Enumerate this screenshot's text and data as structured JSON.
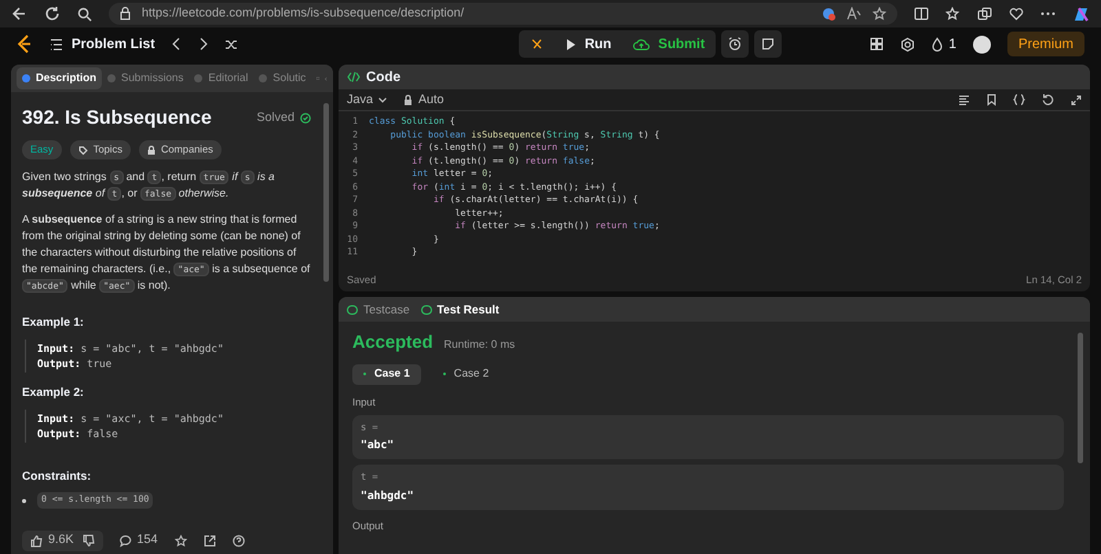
{
  "browser": {
    "url": "https://leetcode.com/problems/is-subsequence/description/"
  },
  "topbar": {
    "problem_list": "Problem List",
    "run": "Run",
    "submit": "Submit",
    "streak": "1",
    "premium": "Premium"
  },
  "description": {
    "tabs": [
      {
        "label": "Description",
        "selected": true
      },
      {
        "label": "Submissions",
        "selected": false
      },
      {
        "label": "Editorial",
        "selected": false
      },
      {
        "label": "Solutic",
        "selected": false
      }
    ],
    "title": "392. Is Subsequence",
    "status": "Solved",
    "tags": [
      {
        "label": "Easy",
        "kind": "difficulty"
      },
      {
        "label": "Topics",
        "kind": "topics"
      },
      {
        "label": "Companies",
        "kind": "companies"
      }
    ],
    "paragraphs": [
      [
        {
          "text": "Given two strings ",
          "kind": "text"
        },
        {
          "text": "s",
          "kind": "code"
        },
        {
          "text": " and ",
          "kind": "text"
        },
        {
          "text": "t",
          "kind": "code"
        },
        {
          "text": ", return ",
          "kind": "text"
        },
        {
          "text": "true",
          "kind": "code"
        },
        {
          "text": " if ",
          "kind": "italic"
        },
        {
          "text": "s",
          "kind": "code"
        },
        {
          "text": " is a ",
          "kind": "italic"
        },
        {
          "text": "subsequence",
          "kind": "bolditalic"
        },
        {
          "text": " of ",
          "kind": "italic"
        },
        {
          "text": "t",
          "kind": "code"
        },
        {
          "text": ", or ",
          "kind": "text"
        },
        {
          "text": "false",
          "kind": "code"
        },
        {
          "text": " otherwise.",
          "kind": "italic"
        }
      ],
      [
        {
          "text": "A ",
          "kind": "text"
        },
        {
          "text": "subsequence",
          "kind": "bold"
        },
        {
          "text": " of a string is a new string that is formed from the original string by deleting some (can be none) of the characters without disturbing the relative positions of the remaining characters. (i.e., ",
          "kind": "text"
        },
        {
          "text": "\"ace\"",
          "kind": "code"
        },
        {
          "text": " is a subsequence of ",
          "kind": "text"
        },
        {
          "text": "\"abcde\"",
          "kind": "code"
        },
        {
          "text": " while ",
          "kind": "text"
        },
        {
          "text": "\"aec\"",
          "kind": "code"
        },
        {
          "text": " is not).",
          "kind": "text"
        }
      ]
    ],
    "examples": [
      {
        "title": "Example 1:",
        "input_label": "Input:",
        "input": "s = \"abc\", t = \"ahbgdc\"",
        "output_label": "Output:",
        "output": "true"
      },
      {
        "title": "Example 2:",
        "input_label": "Input:",
        "input": "s = \"axc\", t = \"ahbgdc\"",
        "output_label": "Output:",
        "output": "false"
      }
    ],
    "constraints_title": "Constraints:",
    "constraints": [
      "0 <= s.length <= 100"
    ],
    "likes": "9.6K",
    "comments": "154"
  },
  "code": {
    "title": "Code",
    "language": "Java",
    "mode": "Auto",
    "line_numbers": [
      "1",
      "2",
      "3",
      "4",
      "5",
      "6",
      "7",
      "8",
      "9",
      "10",
      "11"
    ],
    "lines": [
      [
        {
          "text": "class ",
          "kind": "keyword"
        },
        {
          "text": "Solution",
          "kind": "type"
        },
        {
          "text": " {",
          "kind": "plain"
        }
      ],
      [
        {
          "text": "    public boolean ",
          "kind": "keyword"
        },
        {
          "text": "isSubsequence",
          "kind": "name"
        },
        {
          "text": "(",
          "kind": "plain"
        },
        {
          "text": "String",
          "kind": "type"
        },
        {
          "text": " s, ",
          "kind": "plain"
        },
        {
          "text": "String",
          "kind": "type"
        },
        {
          "text": " t) {",
          "kind": "plain"
        }
      ],
      [
        {
          "text": "        if",
          "kind": "control"
        },
        {
          "text": " (s.length() == ",
          "kind": "plain"
        },
        {
          "text": "0",
          "kind": "number"
        },
        {
          "text": ") ",
          "kind": "plain"
        },
        {
          "text": "return ",
          "kind": "control"
        },
        {
          "text": "true",
          "kind": "keyword"
        },
        {
          "text": ";",
          "kind": "plain"
        }
      ],
      [
        {
          "text": "        if",
          "kind": "control"
        },
        {
          "text": " (t.length() == ",
          "kind": "plain"
        },
        {
          "text": "0",
          "kind": "number"
        },
        {
          "text": ") ",
          "kind": "plain"
        },
        {
          "text": "return ",
          "kind": "control"
        },
        {
          "text": "false",
          "kind": "keyword"
        },
        {
          "text": ";",
          "kind": "plain"
        }
      ],
      [
        {
          "text": "        int",
          "kind": "keyword"
        },
        {
          "text": " letter = ",
          "kind": "plain"
        },
        {
          "text": "0",
          "kind": "number"
        },
        {
          "text": ";",
          "kind": "plain"
        }
      ],
      [
        {
          "text": "        for",
          "kind": "control"
        },
        {
          "text": " (",
          "kind": "plain"
        },
        {
          "text": "int",
          "kind": "keyword"
        },
        {
          "text": " i = ",
          "kind": "plain"
        },
        {
          "text": "0",
          "kind": "number"
        },
        {
          "text": "; i < t.length(); i++) {",
          "kind": "plain"
        }
      ],
      [
        {
          "text": "            if",
          "kind": "control"
        },
        {
          "text": " (s.charAt(letter) == t.charAt(i)) {",
          "kind": "plain"
        }
      ],
      [
        {
          "text": "                letter++;",
          "kind": "plain"
        }
      ],
      [
        {
          "text": "                if",
          "kind": "control"
        },
        {
          "text": " (letter >= s.length()) ",
          "kind": "plain"
        },
        {
          "text": "return ",
          "kind": "control"
        },
        {
          "text": "true",
          "kind": "keyword"
        },
        {
          "text": ";",
          "kind": "plain"
        }
      ],
      [
        {
          "text": "            }",
          "kind": "plain"
        }
      ],
      [
        {
          "text": "        }",
          "kind": "plain"
        }
      ]
    ],
    "status": "Saved",
    "cursor": "Ln 14, Col 2"
  },
  "results": {
    "tabs": [
      {
        "label": "Testcase",
        "selected": false
      },
      {
        "label": "Test Result",
        "selected": true
      }
    ],
    "verdict": "Accepted",
    "runtime": "Runtime: 0 ms",
    "cases": [
      {
        "label": "Case 1",
        "selected": true
      },
      {
        "label": "Case 2",
        "selected": false
      }
    ],
    "input_label": "Input",
    "inputs": [
      {
        "name": "s =",
        "value": "\"abc\""
      },
      {
        "name": "t =",
        "value": "\"ahbgdc\""
      }
    ],
    "output_label": "Output"
  }
}
